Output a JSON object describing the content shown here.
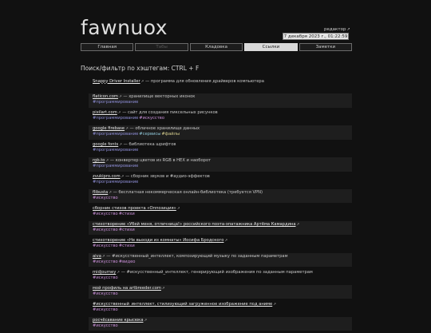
{
  "site": {
    "logo": "fawnuox",
    "editor_label": "редактор",
    "datetime": "7 декабря 2023 г., 01:22:59"
  },
  "tabs": [
    {
      "label": "Главная",
      "state": "normal"
    },
    {
      "label": "Табы",
      "state": "disabled"
    },
    {
      "label": "Кладовка",
      "state": "normal"
    },
    {
      "label": "Ссылки",
      "state": "active"
    },
    {
      "label": "Заметки",
      "state": "normal"
    }
  ],
  "search_hint": "Поиск/фильтр по хэштегам: CTRL + F",
  "colors": {
    "программирование": "#8f8fd8",
    "искусство": "#c98fd8",
    "сервисы": "#8fc7d8",
    "файлы": "#d8d08f",
    "стихи": "#c98fd8",
    "видео": "#c98fd8",
    "звуки": "#c98fd8"
  },
  "items": [
    {
      "link": "Snappy Driver Installer",
      "desc": " — программа для обновления драйверов компьютера",
      "tags": []
    },
    {
      "link": "flaticon.com",
      "desc": " — хранилище векторных иконок",
      "tags": [
        "программирование"
      ]
    },
    {
      "link": "pixilart.com",
      "desc": " — сайт для создания пиксельных рисунков",
      "tags": [
        "программирование",
        "искусство"
      ]
    },
    {
      "link": "google firebase",
      "desc": " — облачное хранилище данных",
      "tags": [
        "программирование",
        "сервисы",
        "файлы"
      ]
    },
    {
      "link": "google fonts",
      "desc": " — библиотека шрифтов",
      "tags": [
        "программирование"
      ]
    },
    {
      "link": "rgb.to",
      "desc": " — конвертер цветов из RGB в HEX и наоборот",
      "tags": [
        "программирование"
      ]
    },
    {
      "link": "zvukipro.com",
      "desc": " — сборник звуков и #аудио-эффектов",
      "tags": [
        "программирование"
      ]
    },
    {
      "link": "flibusta",
      "desc": " — бесплатная некоммерческая онлайн-библиотека (требуется VPN)",
      "tags": [
        "искусство"
      ]
    },
    {
      "link": "сборник стихов проекта «Оппозиция»",
      "desc": "",
      "tags": [
        "искусство",
        "стихи"
      ]
    },
    {
      "link": "стихотворение «Убей меня, отличница!» российского поэта-эпатажника Артёма Камардина",
      "desc": "",
      "tags": [
        "искусство",
        "стихи"
      ]
    },
    {
      "link": "стихотворение «Не выходи из комнаты» Иосифа Бродского",
      "desc": "",
      "tags": [
        "искусство",
        "стихи"
      ]
    },
    {
      "link": "aiva",
      "desc": " — #искусственный_интеллект, композирующий музыку по заданным параметрам",
      "tags": [
        "искусство",
        "видео"
      ]
    },
    {
      "link": "midjourney",
      "desc": " — #искусственный_интеллект, генерирующий изображения по заданным параметрам",
      "tags": [
        "искусство"
      ]
    },
    {
      "link": "мой профиль на artbreeder.com",
      "desc": "",
      "tags": [
        "искусство"
      ]
    },
    {
      "link": "#искусственный_интеллект, стилизующий загруженное изображение под аниме",
      "desc": "",
      "tags": [
        "искусство"
      ]
    },
    {
      "link": "росчёсавание крысюка",
      "desc": "",
      "tags": [
        "искусство"
      ]
    }
  ]
}
